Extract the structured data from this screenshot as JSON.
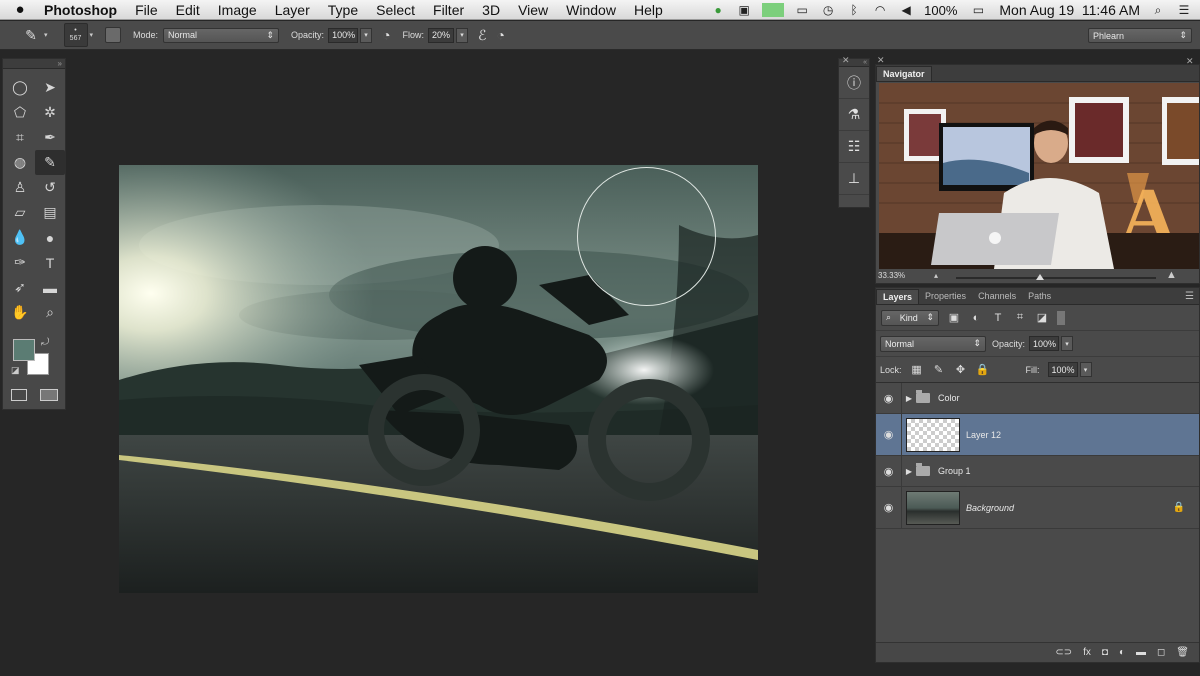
{
  "menubar": {
    "apple": "",
    "app": "Photoshop",
    "items": [
      "File",
      "Edit",
      "Image",
      "Layer",
      "Type",
      "Select",
      "Filter",
      "3D",
      "View",
      "Window",
      "Help"
    ],
    "battery": "100%",
    "clock": "Mon Aug 19  11:46 AM"
  },
  "options": {
    "brush_size": "567",
    "mode_label": "Mode:",
    "mode_value": "Normal",
    "opacity_label": "Opacity:",
    "opacity_value": "100%",
    "flow_label": "Flow:",
    "flow_value": "20%",
    "workspace": "Phlearn"
  },
  "navigator": {
    "tab": "Navigator",
    "zoom": "33.33%"
  },
  "layers_panel": {
    "tabs": [
      "Layers",
      "Properties",
      "Channels",
      "Paths"
    ],
    "filter_kind": "Kind",
    "blend_mode": "Normal",
    "opacity_label": "Opacity:",
    "opacity_value": "100%",
    "lock_label": "Lock:",
    "fill_label": "Fill:",
    "fill_value": "100%",
    "layers": [
      {
        "name": "Color",
        "type": "group"
      },
      {
        "name": "Layer 12",
        "type": "layer",
        "selected": true
      },
      {
        "name": "Group 1",
        "type": "group"
      },
      {
        "name": "Background",
        "type": "background",
        "locked": true
      }
    ]
  },
  "colors": {
    "foreground": "#5b7c73",
    "background": "#ffffff",
    "selection": "#5f7593"
  }
}
